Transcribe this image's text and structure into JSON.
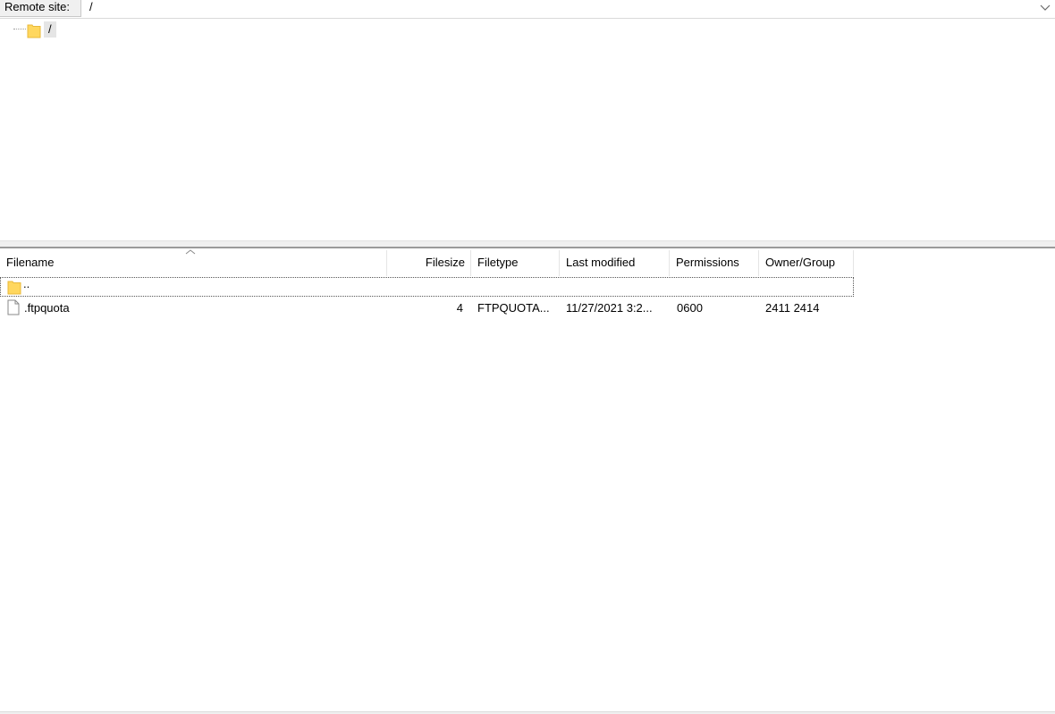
{
  "pathbar": {
    "label": "Remote site:",
    "path": "/"
  },
  "tree": {
    "root_label": "/"
  },
  "filelist": {
    "columns": [
      "Filename",
      "Filesize",
      "Filetype",
      "Last modified",
      "Permissions",
      "Owner/Group"
    ],
    "rows": [
      {
        "filename": "..",
        "filesize": "",
        "filetype": "",
        "modified": "",
        "permissions": "",
        "owner": ""
      },
      {
        "filename": ".ftpquota",
        "filesize": "4",
        "filetype": "FTPQUOTA...",
        "modified": "11/27/2021 3:2...",
        "permissions": "0600",
        "owner": "2411 2414"
      }
    ]
  },
  "icons": {
    "path_dropdown": "chevron-down-icon",
    "tree_folder": "folder-icon",
    "parent_folder": "folder-icon",
    "file": "file-icon",
    "sort": "sort-up-icon"
  },
  "colors": {
    "folder": "#ffd75e",
    "folder_dark": "#e8b93a",
    "selection_gray": "#e5e5e5"
  }
}
